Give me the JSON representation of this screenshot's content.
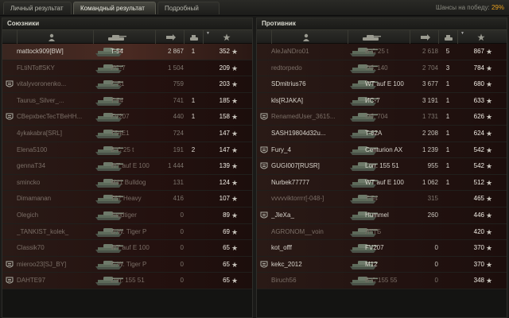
{
  "tabs": [
    {
      "label": "Личный результат",
      "active": false
    },
    {
      "label": "Командный результат",
      "active": true
    },
    {
      "label": "Подробный отчёт",
      "active": false
    }
  ],
  "chance": {
    "label": "Шансы на победу:",
    "value": "29%",
    "accent": "#e8a020"
  },
  "allies": {
    "title": "Союзники",
    "rows": [
      {
        "platoon": false,
        "name": "mattock909[BW]",
        "tank": "T-54",
        "damage": "2 867",
        "kills": "1",
        "xp": "352",
        "me": true,
        "dead": false
      },
      {
        "platoon": false,
        "name": "FLtiNToffSKY",
        "tank": "ИС-7",
        "damage": "1 504",
        "kills": "",
        "xp": "209",
        "me": false,
        "dead": true
      },
      {
        "platoon": true,
        "name": "vitalyvoronenko...",
        "tank": "C-51",
        "damage": "759",
        "kills": "",
        "xp": "203",
        "me": false,
        "dead": true
      },
      {
        "platoon": false,
        "name": "Taurus_Silver_...",
        "tank": "T-54",
        "damage": "741",
        "kills": "1",
        "xp": "185",
        "me": false,
        "dead": true
      },
      {
        "platoon": true,
        "name": "CBepxbecTecTBeHH...",
        "tank": "FV207",
        "damage": "440",
        "kills": "1",
        "xp": "158",
        "me": false,
        "dead": true
      },
      {
        "platoon": false,
        "name": "4ykakabra[SRL]",
        "tank": "T54E1",
        "damage": "724",
        "kills": "",
        "xp": "147",
        "me": false,
        "dead": true
      },
      {
        "platoon": false,
        "name": "Elena5100",
        "tank": "B-C 25 t",
        "damage": "191",
        "kills": "2",
        "xp": "147",
        "me": false,
        "dead": true
      },
      {
        "platoon": false,
        "name": "gennaT34",
        "tank": "WT auf E 100",
        "damage": "1 444",
        "kills": "",
        "xp": "139",
        "me": false,
        "dead": true
      },
      {
        "platoon": false,
        "name": "smincko",
        "tank": "M41 Bulldog",
        "damage": "131",
        "kills": "",
        "xp": "124",
        "me": false,
        "dead": true
      },
      {
        "platoon": false,
        "name": "Dimamanan",
        "tank": "T57 Heavy",
        "damage": "416",
        "kills": "",
        "xp": "107",
        "me": false,
        "dead": true
      },
      {
        "platoon": false,
        "name": "Olegich",
        "tank": "Jagdtiger",
        "damage": "0",
        "kills": "",
        "xp": "89",
        "me": false,
        "dead": true
      },
      {
        "platoon": false,
        "name": "_TANKIST_kolek_",
        "tank": "G.W. Tiger P",
        "damage": "0",
        "kills": "",
        "xp": "69",
        "me": false,
        "dead": true
      },
      {
        "platoon": false,
        "name": "Classik70",
        "tank": "WT auf E 100",
        "damage": "0",
        "kills": "",
        "xp": "65",
        "me": false,
        "dead": true
      },
      {
        "platoon": true,
        "name": "mieroo23[SJ_BY]",
        "tank": "G.W. Tiger P",
        "damage": "0",
        "kills": "",
        "xp": "65",
        "me": false,
        "dead": true
      },
      {
        "platoon": true,
        "name": "DAHTE97",
        "tank": "Lorr. 155 51",
        "damage": "0",
        "kills": "",
        "xp": "65",
        "me": false,
        "dead": true
      }
    ]
  },
  "enemies": {
    "title": "Противник",
    "rows": [
      {
        "platoon": false,
        "name": "AleJaNDro01",
        "tank": "B-C 25 t",
        "damage": "2 618",
        "kills": "5",
        "xp": "867",
        "dead": true
      },
      {
        "platoon": false,
        "name": "redtorpedo",
        "tank": "Об. 140",
        "damage": "2 704",
        "kills": "3",
        "xp": "784",
        "dead": true
      },
      {
        "platoon": false,
        "name": "SDmitrius76",
        "tank": "WT auf E 100",
        "damage": "3 677",
        "kills": "1",
        "xp": "680",
        "dead": false
      },
      {
        "platoon": false,
        "name": "kls[RJAKA]",
        "tank": "ИС-7",
        "damage": "3 191",
        "kills": "1",
        "xp": "633",
        "dead": false
      },
      {
        "platoon": true,
        "name": "RenamedUser_3615...",
        "tank": "Об. 704",
        "damage": "1 731",
        "kills": "1",
        "xp": "626",
        "dead": true
      },
      {
        "platoon": false,
        "name": "SASH19804d32u...",
        "tank": "T-62A",
        "damage": "2 208",
        "kills": "1",
        "xp": "624",
        "dead": false
      },
      {
        "platoon": true,
        "name": "Fury_4",
        "tank": "Centurion AX",
        "damage": "1 239",
        "kills": "1",
        "xp": "542",
        "dead": false
      },
      {
        "platoon": true,
        "name": "GUGI007[RUSR]",
        "tank": "Lorr. 155 51",
        "damage": "955",
        "kills": "1",
        "xp": "542",
        "dead": false
      },
      {
        "platoon": false,
        "name": "Nurbek77777",
        "tank": "WT auf E 100",
        "damage": "1 062",
        "kills": "1",
        "xp": "512",
        "dead": false
      },
      {
        "platoon": false,
        "name": "vvvvviktorrrr[-048-]",
        "tank": "T-54",
        "damage": "315",
        "kills": "",
        "xp": "465",
        "dead": true
      },
      {
        "platoon": true,
        "name": "_JleXa_",
        "tank": "Hummel",
        "damage": "260",
        "kills": "",
        "xp": "446",
        "dead": false
      },
      {
        "platoon": false,
        "name": "AGRONOM__voin",
        "tank": "ЛТТБ",
        "damage": "",
        "kills": "",
        "xp": "420",
        "dead": true
      },
      {
        "platoon": false,
        "name": "kot_offf",
        "tank": "FV207",
        "damage": "0",
        "kills": "",
        "xp": "370",
        "dead": false
      },
      {
        "platoon": true,
        "name": "kekc_2012",
        "tank": "M12",
        "damage": "0",
        "kills": "",
        "xp": "370",
        "dead": false
      },
      {
        "platoon": false,
        "name": "Biruch56",
        "tank": "B-C 155 55",
        "damage": "0",
        "kills": "",
        "xp": "348",
        "dead": true
      }
    ]
  },
  "icons": {
    "platoon": "platoon-icon",
    "player": "player-icon",
    "vehicle": "tank-icon",
    "damage": "damage-icon",
    "kills": "kills-icon",
    "xp": "star-icon"
  }
}
